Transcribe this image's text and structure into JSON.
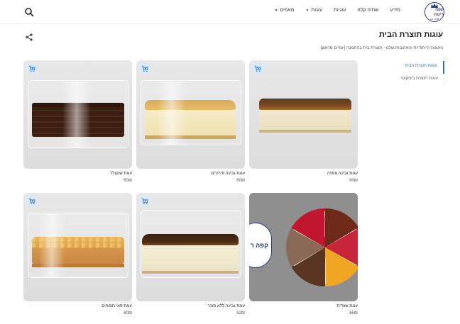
{
  "header": {
    "logo": {
      "text": "קפה ריטה",
      "sub": "est. 1968"
    },
    "nav": [
      {
        "label": "מאפים",
        "dropdown": true
      },
      {
        "label": "עוגות",
        "dropdown": true
      },
      {
        "label": "עוגיות",
        "dropdown": false
      },
      {
        "label": "שתיה קלה",
        "dropdown": false
      },
      {
        "label": "מידע",
        "dropdown": false
      }
    ]
  },
  "page": {
    "title": "עוגות תוצרת הבית",
    "subtitle": "העוגות הייחודיות והאהובות שלנו - תוצרת בית בהתמנה [יומיים מראש]"
  },
  "sidebar": {
    "items": [
      {
        "label": "עוגות תוצרת הבית",
        "active": true
      },
      {
        "label": "עוגות תוצרת ביסקוטי",
        "active": false
      }
    ]
  },
  "products": [
    {
      "name": "עוגת גבינה אפויה",
      "price": "60₪"
    },
    {
      "name": "עוגת גבינה פירורים",
      "price": "60₪"
    },
    {
      "name": "עוגת שוקולד",
      "price": "50₪"
    },
    {
      "name": "עוגת שוודית",
      "price": "65₪"
    },
    {
      "name": "עוגת גבינה ללא סוכר",
      "price": "52₪"
    },
    {
      "name": "עוגת פאי תפוחים",
      "price": "60₪"
    }
  ],
  "badge": {
    "text": "קפה ר"
  },
  "colors": {
    "accent": "#1e6fcf",
    "cart_bg": "#dceaf8",
    "brand": "#2f3f7a"
  }
}
